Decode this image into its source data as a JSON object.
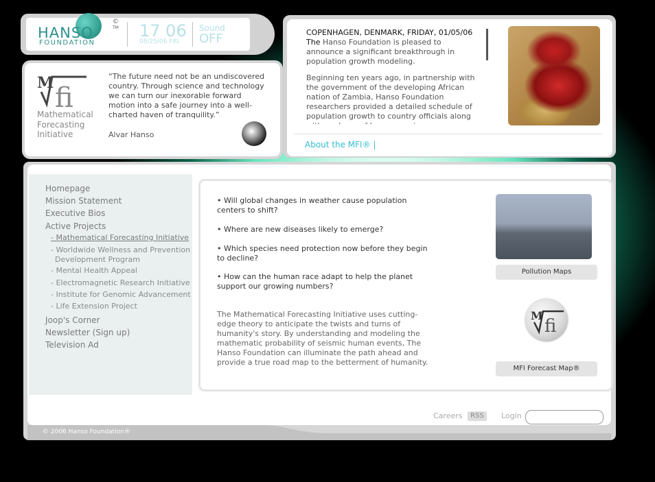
{
  "header": {
    "logo_text": "HANSO",
    "logo_sub": "FOUNDATION",
    "copyright_symbol": "©",
    "trademark": "TM",
    "time": "17 06",
    "date": "08/25/06 FRI",
    "sound_label": "Sound",
    "sound_state": "OFF"
  },
  "quote_box": {
    "logo_text": "MVfi",
    "name_line1": "Mathematical",
    "name_line2": "Forecasting",
    "name_line3": "Initiative",
    "quote": "“The future need not be an undiscovered country. Through science and technology we can turn our inexorable forward motion into a safe journey into a well-charted haven of tranquility.”",
    "author": "Alvar Hanso"
  },
  "news": {
    "lead": "COPENHAGEN, DENMARK, FRIDAY, 01/05/06 The",
    "para1": "Hanso Foundation is pleased to announce a significant breakthrough in population growth modeling.",
    "para2": "Beginning ten years ago, in partnership with the government of the developing African nation of Zambia, Hanso Foundation researchers provided a detailed schedule of population growth to country officials along with analyses of how a growing",
    "about_link": "About the MFI® |"
  },
  "nav": {
    "items": [
      "Homepage",
      "Mission Statement",
      "Executive Bios",
      "Active Projects"
    ],
    "subitems": [
      "- Mathematical Forecasting Initiative",
      "- Worldwide Wellness and Prevention",
      "  Development Program",
      "- Mental Health Appeal",
      "- Electromagnetic Research Initiative",
      "- Institute for Genomic Advancement",
      "- Life Extension Project"
    ],
    "items_bottom": [
      "Joop's Corner",
      "Newsletter (Sign up)",
      "Television Ad"
    ]
  },
  "content": {
    "questions": [
      "• Will global changes in weather cause population centers to shift?",
      "• Where are new diseases likely to emerge?",
      "• Which species need protection now before they begin to decline?",
      "• How can the human race adapt to help the planet support our growing numbers?"
    ],
    "description": "The Mathematical Forecasting Initiative uses cutting-edge theory to anticipate the twists and turns of humanity's story.  By understanding and modeling the mathematic probability of seismic human events, The Hanso Foundation can illuminate the path ahead and provide a true road map to the betterment of humanity.",
    "pollution_button": "Pollution Maps",
    "forecast_button": "MFI Forecast Map®",
    "mfi_round_logo": "MVfi"
  },
  "footer": {
    "careers": "Careers",
    "rss": "RSS",
    "login_label": "Login",
    "login_value": "",
    "copyright": "© 2006 Hanso Foundation®"
  }
}
